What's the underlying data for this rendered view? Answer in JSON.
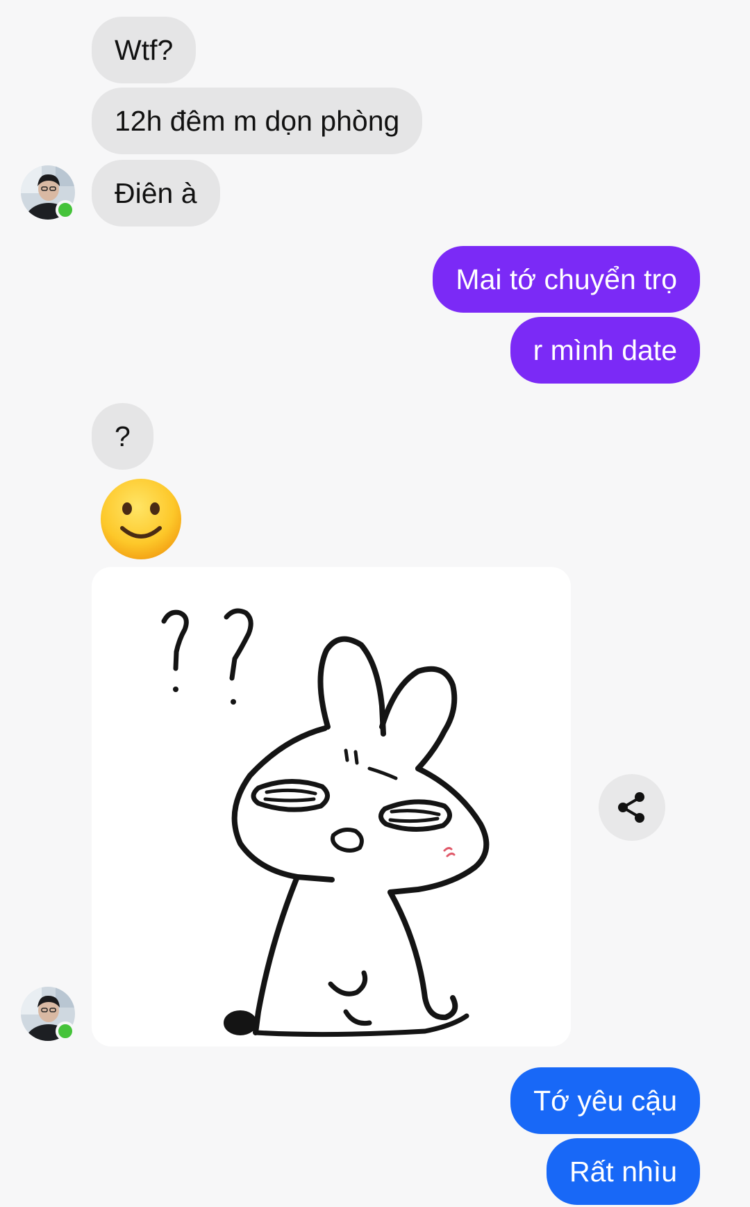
{
  "colors": {
    "background": "#f7f7f8",
    "incoming_bubble": "#e5e5e6",
    "outgoing_purple": "#7b2af6",
    "outgoing_blue": "#1868f7",
    "online_status": "#45c33a"
  },
  "conversation": {
    "incoming_group_1": [
      "Wtf?",
      "12h đêm m dọn phòng",
      "Điên à"
    ],
    "outgoing_group_1": [
      "Mai tớ chuyển trọ",
      "r mình date"
    ],
    "incoming_group_2": [
      "?"
    ],
    "emoji": "slightly-smiling-face",
    "sticker": "confused-rabbit-sticker",
    "outgoing_group_2": [
      "Tớ yêu cậu",
      "Rất nhìu"
    ]
  },
  "icons": {
    "share": "share-icon",
    "avatar": "contact-avatar"
  }
}
